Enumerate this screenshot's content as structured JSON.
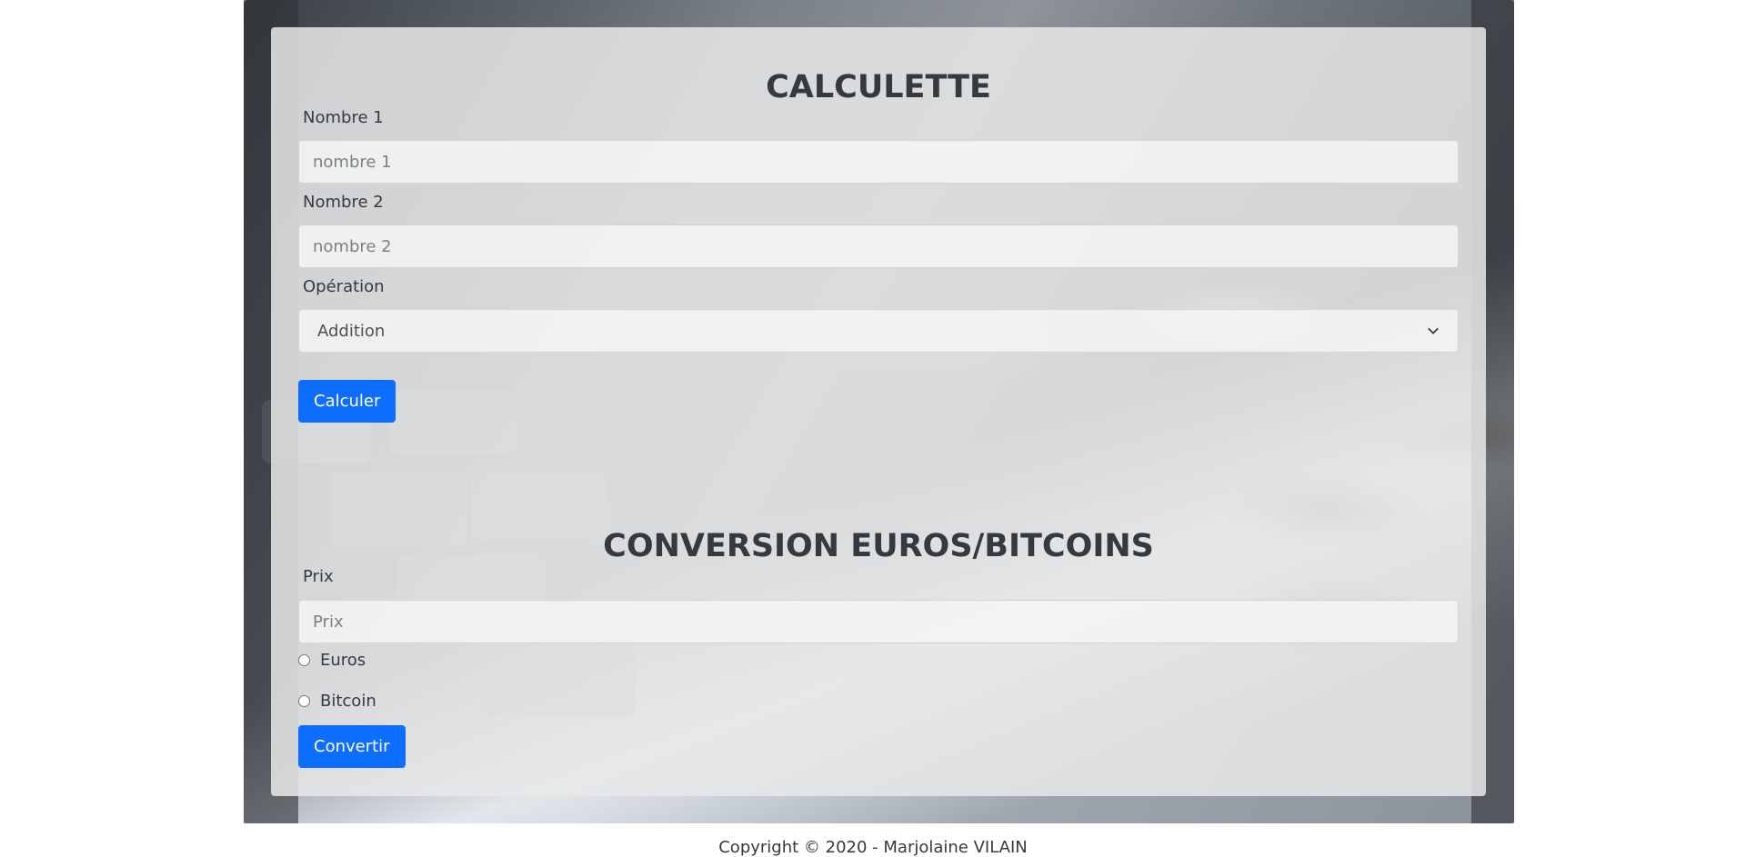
{
  "calculator": {
    "title": "CALCULETTE",
    "number1": {
      "label": "Nombre 1",
      "placeholder": "nombre 1",
      "value": ""
    },
    "number2": {
      "label": "Nombre 2",
      "placeholder": "nombre 2",
      "value": ""
    },
    "operation": {
      "label": "Opération",
      "selected": "Addition"
    },
    "submit_label": "Calculer"
  },
  "converter": {
    "title": "CONVERSION EUROS/BITCOINS",
    "price": {
      "label": "Prix",
      "placeholder": "Prix",
      "value": ""
    },
    "options": [
      {
        "label": "Euros",
        "checked": false
      },
      {
        "label": "Bitcoin",
        "checked": false
      }
    ],
    "submit_label": "Convertir"
  },
  "footer": {
    "text": "Copyright © 2020 - Marjolaine VILAIN"
  },
  "colors": {
    "primary": "#0d6efd",
    "panel": "#e8e8e8",
    "text": "#343a40"
  }
}
